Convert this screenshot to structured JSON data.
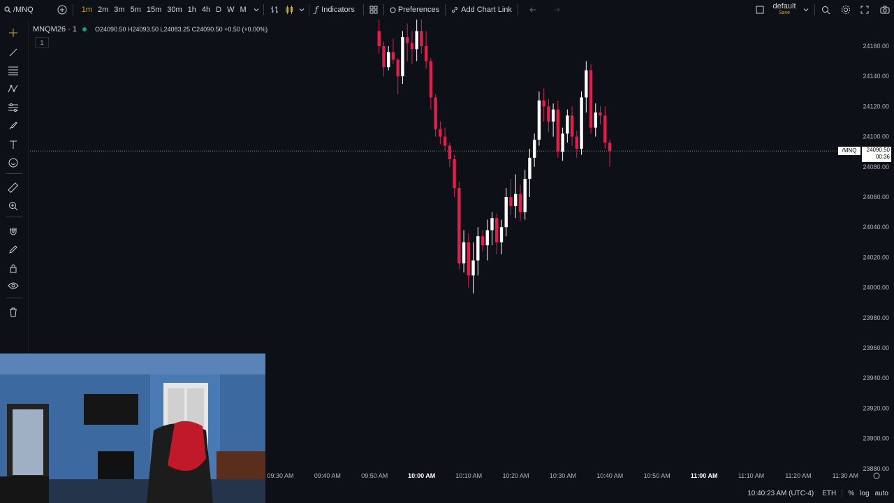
{
  "toolbar": {
    "symbol": "/MNQ",
    "intervals": [
      "1m",
      "2m",
      "3m",
      "5m",
      "15m",
      "30m",
      "1h",
      "4h",
      "D",
      "W",
      "M"
    ],
    "active_interval": "1m",
    "indicators_label": "Indicators",
    "preferences_label": "Preferences",
    "chart_link_label": "Add Chart Link",
    "layout_name": "default",
    "layout_save": "Save"
  },
  "legend": {
    "symbol": "MNQM26 · 1",
    "ohlc": "O24090.50  H24093.50  L24083.25  C24090.50  +0.50 (+0.00%)",
    "sub_count": "1"
  },
  "price_tag": {
    "symbol": "/MNQ",
    "price": "24090.50",
    "countdown": "00:36"
  },
  "footer": {
    "clock": "10:40:23 AM (UTC-4)",
    "session": "ETH",
    "percent": "%",
    "log": "log",
    "auto": "auto"
  },
  "colors": {
    "background": "#0e1017",
    "up_candle": "#ffffff",
    "down_candle": "#e0204a",
    "accent": "#d4a72c"
  },
  "chart_data": {
    "type": "candlestick",
    "y_ticks": [
      "24160.00",
      "24140.00",
      "24120.00",
      "24100.00",
      "24080.00",
      "24060.00",
      "24040.00",
      "24020.00",
      "24000.00",
      "23980.00",
      "23960.00",
      "23940.00",
      "23920.00",
      "23900.00",
      "23880.00"
    ],
    "x_ticks": [
      {
        "label": "09:30 AM",
        "bold": false
      },
      {
        "label": "09:40 AM",
        "bold": false
      },
      {
        "label": "09:50 AM",
        "bold": false
      },
      {
        "label": "10:00 AM",
        "bold": true
      },
      {
        "label": "10:10 AM",
        "bold": false
      },
      {
        "label": "10:20 AM",
        "bold": false
      },
      {
        "label": "10:30 AM",
        "bold": false
      },
      {
        "label": "10:40 AM",
        "bold": false
      },
      {
        "label": "10:50 AM",
        "bold": false
      },
      {
        "label": "11:00 AM",
        "bold": true
      },
      {
        "label": "11:10 AM",
        "bold": false
      },
      {
        "label": "11:20 AM",
        "bold": false
      },
      {
        "label": "11:30 AM",
        "bold": false
      }
    ],
    "current_price": 24090.5,
    "candles": [
      [
        24170,
        24180,
        24155,
        24160
      ],
      [
        24160,
        24163,
        24140,
        24146
      ],
      [
        24146,
        24160,
        24144,
        24156
      ],
      [
        24156,
        24165,
        24148,
        24151
      ],
      [
        24151,
        24152,
        24128,
        24140
      ],
      [
        24140,
        24170,
        24135,
        24166
      ],
      [
        24166,
        24175,
        24150,
        24162
      ],
      [
        24162,
        24170,
        24148,
        24158
      ],
      [
        24158,
        24180,
        24150,
        24170
      ],
      [
        24170,
        24180,
        24155,
        24160
      ],
      [
        24160,
        24170,
        24145,
        24150
      ],
      [
        24150,
        24152,
        24118,
        24126
      ],
      [
        24126,
        24128,
        24100,
        24105
      ],
      [
        24105,
        24110,
        24095,
        24100
      ],
      [
        24100,
        24106,
        24090,
        24094
      ],
      [
        24094,
        24096,
        24080,
        24085
      ],
      [
        24085,
        24088,
        24060,
        24066
      ],
      [
        24066,
        24070,
        24012,
        24016
      ],
      [
        24016,
        24038,
        24010,
        24030
      ],
      [
        24030,
        24036,
        24000,
        24008
      ],
      [
        24008,
        24030,
        23996,
        24018
      ],
      [
        24018,
        24040,
        24008,
        24034
      ],
      [
        24034,
        24038,
        24024,
        24028
      ],
      [
        24028,
        24045,
        24018,
        24038
      ],
      [
        24038,
        24050,
        24028,
        24046
      ],
      [
        24046,
        24049,
        24022,
        24030
      ],
      [
        24030,
        24045,
        24022,
        24040
      ],
      [
        24040,
        24066,
        24034,
        24060
      ],
      [
        24060,
        24072,
        24048,
        24054
      ],
      [
        24054,
        24075,
        24046,
        24062
      ],
      [
        24062,
        24068,
        24044,
        24050
      ],
      [
        24050,
        24078,
        24045,
        24072
      ],
      [
        24072,
        24092,
        24060,
        24086
      ],
      [
        24086,
        24102,
        24080,
        24098
      ],
      [
        24098,
        24130,
        24094,
        24124
      ],
      [
        24124,
        24132,
        24110,
        24120
      ],
      [
        24120,
        24125,
        24103,
        24110
      ],
      [
        24110,
        24122,
        24100,
        24118
      ],
      [
        24118,
        24124,
        24086,
        24090
      ],
      [
        24090,
        24106,
        24084,
        24102
      ],
      [
        24102,
        24118,
        24096,
        24114
      ],
      [
        24114,
        24120,
        24094,
        24100
      ],
      [
        24100,
        24104,
        24086,
        24092
      ],
      [
        24092,
        24130,
        24088,
        24126
      ],
      [
        24126,
        24150,
        24116,
        24144
      ],
      [
        24144,
        24148,
        24102,
        24106
      ],
      [
        24106,
        24122,
        24100,
        24116
      ],
      [
        24116,
        24120,
        24108,
        24114
      ],
      [
        24114,
        24120,
        24092,
        24096
      ],
      [
        24096,
        24098,
        24080,
        24090.5
      ]
    ]
  }
}
